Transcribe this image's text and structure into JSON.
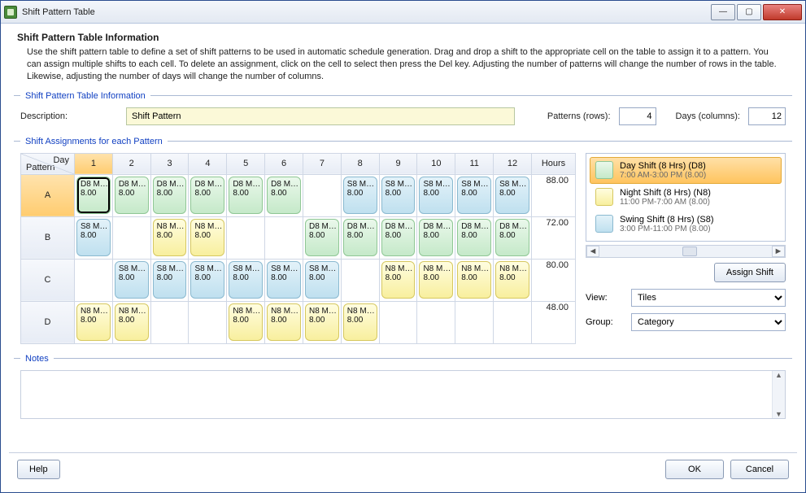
{
  "window": {
    "title": "Shift Pattern Table"
  },
  "intro": {
    "heading": "Shift Pattern Table Information",
    "text": "Use the shift pattern table to define a set of shift patterns to be used in automatic schedule generation. Drag and drop a shift to the appropriate cell on the table to assign it to a pattern. You can assign multiple shifts to each cell. To delete an assignment, click on the cell to select then press the Del key.  Adjusting the number of patterns will change the number of rows in the table. Likewise, adjusting the number of days will change the number of columns."
  },
  "section_info": {
    "legend": "Shift Pattern Table Information",
    "descriptionLabel": "Description:",
    "descriptionValue": "Shift Pattern",
    "patternsLabel": "Patterns (rows):",
    "patternsValue": "4",
    "daysLabel": "Days (columns):",
    "daysValue": "12"
  },
  "section_assign": {
    "legend": "Shift Assignments for each Pattern",
    "corner": {
      "upper": "Day",
      "lower": "Pattern"
    },
    "dayHeaders": [
      "1",
      "2",
      "3",
      "4",
      "5",
      "6",
      "7",
      "8",
      "9",
      "10",
      "11",
      "12"
    ],
    "hoursHeader": "Hours",
    "selectedDayIndex": 0,
    "selectedRowIndex": 0,
    "selectedCell": {
      "row": 0,
      "col": 0
    },
    "rows": [
      {
        "label": "A",
        "hours": "88.00",
        "cells": [
          {
            "code": "D8",
            "l1": "D8 M…",
            "l2": "8.00"
          },
          {
            "code": "D8",
            "l1": "D8 M…",
            "l2": "8.00"
          },
          {
            "code": "D8",
            "l1": "D8 M…",
            "l2": "8.00"
          },
          {
            "code": "D8",
            "l1": "D8 M…",
            "l2": "8.00"
          },
          {
            "code": "D8",
            "l1": "D8 M…",
            "l2": "8.00"
          },
          {
            "code": "D8",
            "l1": "D8 M…",
            "l2": "8.00"
          },
          null,
          {
            "code": "S8",
            "l1": "S8 M…",
            "l2": "8.00"
          },
          {
            "code": "S8",
            "l1": "S8 M…",
            "l2": "8.00"
          },
          {
            "code": "S8",
            "l1": "S8 M…",
            "l2": "8.00"
          },
          {
            "code": "S8",
            "l1": "S8 M…",
            "l2": "8.00"
          },
          {
            "code": "S8",
            "l1": "S8 M…",
            "l2": "8.00"
          }
        ]
      },
      {
        "label": "B",
        "hours": "72.00",
        "cells": [
          {
            "code": "S8",
            "l1": "S8 M…",
            "l2": "8.00"
          },
          null,
          {
            "code": "N8",
            "l1": "N8 M…",
            "l2": "8.00"
          },
          {
            "code": "N8",
            "l1": "N8 M…",
            "l2": "8.00"
          },
          null,
          null,
          {
            "code": "D8",
            "l1": "D8 M…",
            "l2": "8.00"
          },
          {
            "code": "D8",
            "l1": "D8 M…",
            "l2": "8.00"
          },
          {
            "code": "D8",
            "l1": "D8 M…",
            "l2": "8.00"
          },
          {
            "code": "D8",
            "l1": "D8 M…",
            "l2": "8.00"
          },
          {
            "code": "D8",
            "l1": "D8 M…",
            "l2": "8.00"
          },
          {
            "code": "D8",
            "l1": "D8 M…",
            "l2": "8.00"
          }
        ]
      },
      {
        "label": "C",
        "hours": "80.00",
        "cells": [
          null,
          {
            "code": "S8",
            "l1": "S8 M…",
            "l2": "8.00"
          },
          {
            "code": "S8",
            "l1": "S8 M…",
            "l2": "8.00"
          },
          {
            "code": "S8",
            "l1": "S8 M…",
            "l2": "8.00"
          },
          {
            "code": "S8",
            "l1": "S8 M…",
            "l2": "8.00"
          },
          {
            "code": "S8",
            "l1": "S8 M…",
            "l2": "8.00"
          },
          {
            "code": "S8",
            "l1": "S8 M…",
            "l2": "8.00"
          },
          null,
          {
            "code": "N8",
            "l1": "N8 M…",
            "l2": "8.00"
          },
          {
            "code": "N8",
            "l1": "N8 M…",
            "l2": "8.00"
          },
          {
            "code": "N8",
            "l1": "N8 M…",
            "l2": "8.00"
          },
          {
            "code": "N8",
            "l1": "N8 M…",
            "l2": "8.00"
          }
        ]
      },
      {
        "label": "D",
        "hours": "48.00",
        "cells": [
          {
            "code": "N8",
            "l1": "N8 M…",
            "l2": "8.00"
          },
          {
            "code": "N8",
            "l1": "N8 M…",
            "l2": "8.00"
          },
          null,
          null,
          {
            "code": "N8",
            "l1": "N8 M…",
            "l2": "8.00"
          },
          {
            "code": "N8",
            "l1": "N8 M…",
            "l2": "8.00"
          },
          {
            "code": "N8",
            "l1": "N8 M…",
            "l2": "8.00"
          },
          {
            "code": "N8",
            "l1": "N8 M…",
            "l2": "8.00"
          },
          null,
          null,
          null,
          null
        ]
      }
    ]
  },
  "palette": {
    "items": [
      {
        "code": "D8",
        "title": "Day Shift (8 Hrs) (D8)",
        "sub": "7:00 AM-3:00 PM (8.00)",
        "selected": true
      },
      {
        "code": "N8",
        "title": "Night Shift (8 Hrs) (N8)",
        "sub": "11:00 PM-7:00 AM (8.00)",
        "selected": false
      },
      {
        "code": "S8",
        "title": "Swing Shift (8 Hrs) (S8)",
        "sub": "3:00 PM-11:00 PM (8.00)",
        "selected": false
      }
    ],
    "assignLabel": "Assign Shift",
    "viewLabel": "View:",
    "viewValue": "Tiles",
    "groupLabel": "Group:",
    "groupValue": "Category"
  },
  "notes": {
    "legend": "Notes",
    "value": ""
  },
  "footer": {
    "help": "Help",
    "ok": "OK",
    "cancel": "Cancel"
  }
}
